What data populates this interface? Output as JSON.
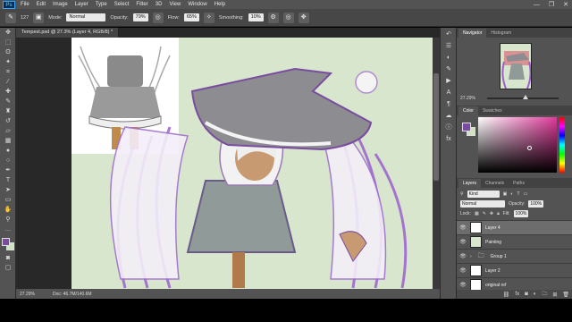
{
  "menubar": {
    "logo": "Ps",
    "items": [
      "File",
      "Edit",
      "Image",
      "Layer",
      "Type",
      "Select",
      "Filter",
      "3D",
      "View",
      "Window",
      "Help"
    ],
    "controls": {
      "minimize": "—",
      "maximize": "❐",
      "close": "✕"
    }
  },
  "options": {
    "brush_size": "127",
    "mode_label": "Mode:",
    "mode_value": "Normal",
    "opacity_label": "Opacity:",
    "opacity_value": "79%",
    "flow_label": "Flow:",
    "flow_value": "65%",
    "smoothing_label": "Smoothing:",
    "smoothing_value": "10%"
  },
  "document": {
    "tab_title": "Tempest.psd @ 27.3% (Layer 4, RGB/8) *",
    "zoom": "27.29%",
    "doc_info": "Doc: 46.7M/140.6M"
  },
  "navigator": {
    "tabs": [
      "Navigator",
      "Histogram"
    ],
    "zoom": "27.29%"
  },
  "color_panel": {
    "tabs": [
      "Color",
      "Swatches"
    ],
    "fg": "#7a4ca0",
    "bg": "#cfe3c3"
  },
  "layers_panel": {
    "tabs": [
      "Layers",
      "Channels",
      "Paths"
    ],
    "kind": "Kind",
    "blend": "Normal",
    "opacity_label": "Opacity:",
    "opacity_value": "100%",
    "lock_label": "Lock:",
    "fill_label": "Fill:",
    "fill_value": "100%",
    "layers": [
      {
        "name": "Layer 4",
        "selected": true,
        "folder": false
      },
      {
        "name": "Painting",
        "selected": false,
        "folder": false
      },
      {
        "name": "Group 1",
        "selected": false,
        "folder": true
      },
      {
        "name": "Layer 2",
        "selected": false,
        "folder": false
      },
      {
        "name": "original ref",
        "selected": false,
        "folder": false
      }
    ]
  },
  "colors": {
    "accent_purple": "#7a4ca0",
    "canvas_bg": "#d8e6cd"
  }
}
